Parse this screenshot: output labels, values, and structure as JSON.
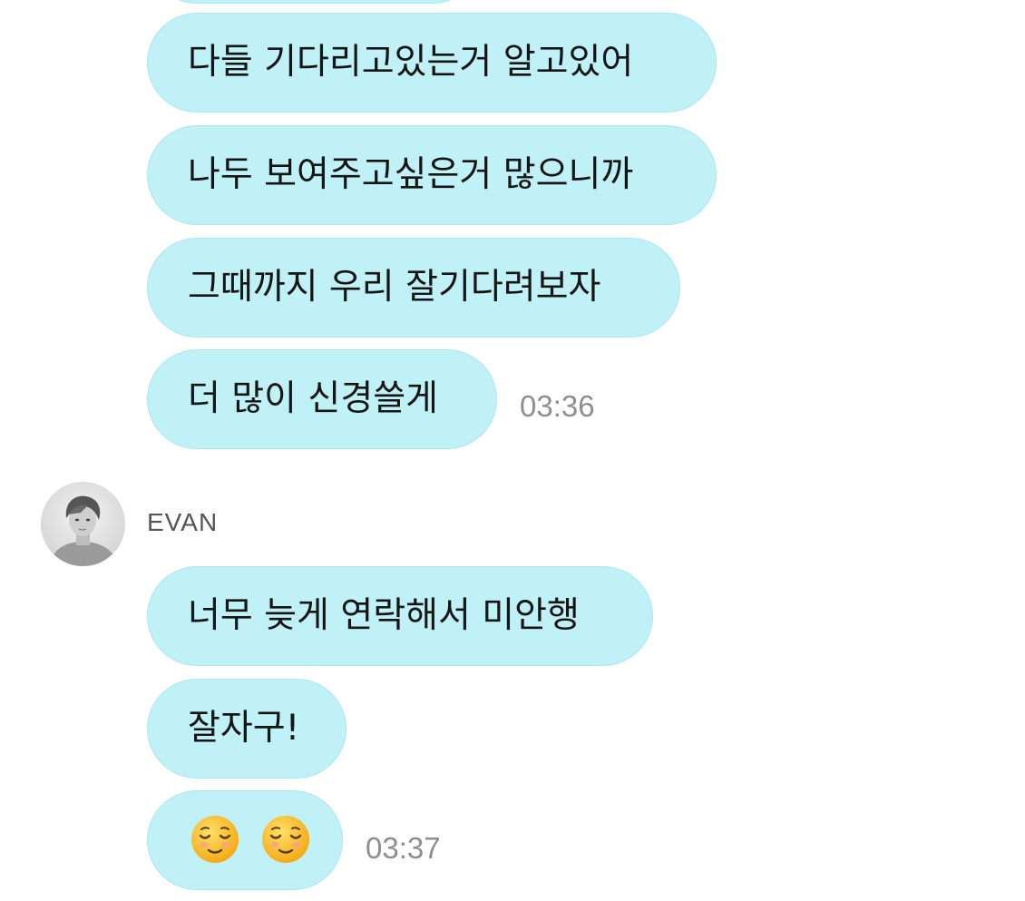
{
  "messages_before": [
    {
      "text": "다들 기다리고있는거 알고있어"
    },
    {
      "text": "나두 보여주고싶은거 많으니까"
    },
    {
      "text": "그때까지 우리 잘기다려보자"
    },
    {
      "text": "더 많이 신경쓸게"
    }
  ],
  "time_1": "03:36",
  "sender": {
    "name": "EVAN",
    "avatar": "profile-photo-grayscale"
  },
  "messages_after": [
    {
      "text": "너무 늦게 연락해서 미안행"
    },
    {
      "text": "잘자구!"
    },
    {
      "emoji": "relieved-face-emoji",
      "count": 2
    }
  ],
  "time_2": "03:37",
  "colors": {
    "bubble": "#c0f1f6",
    "bubble_border": "#aee6ee",
    "timestamp": "#8e8e8e",
    "name": "#555555",
    "emoji_yellow": "#f6bf26"
  }
}
